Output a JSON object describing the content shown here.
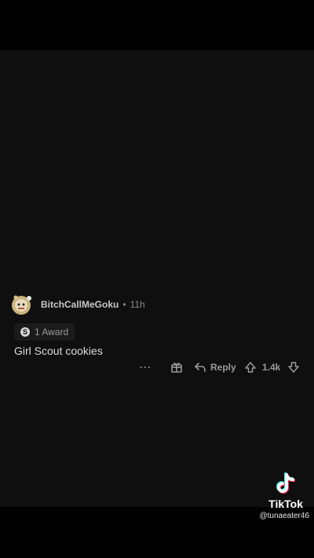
{
  "comment": {
    "username": "BitchCallMeGoku",
    "separator": "•",
    "age": "11h",
    "award_label": "1 Award",
    "body": "Girl Scout cookies",
    "actions": {
      "more": "···",
      "reply": "Reply",
      "score": "1.4k"
    }
  },
  "watermark": {
    "brand": "TikTok",
    "handle": "@tunaeater46"
  },
  "icons": {
    "avatar": "avatar-image",
    "award": "award-icon",
    "gift": "gift-icon",
    "reply": "reply-arrow-icon",
    "upvote": "upvote-arrow-icon",
    "downvote": "downvote-arrow-icon",
    "tiktok": "tiktok-note-icon"
  },
  "colors": {
    "background": "#000000",
    "panel": "#0f0f0f",
    "text_primary": "#dcdcdc",
    "text_secondary": "#9a9a9a"
  }
}
